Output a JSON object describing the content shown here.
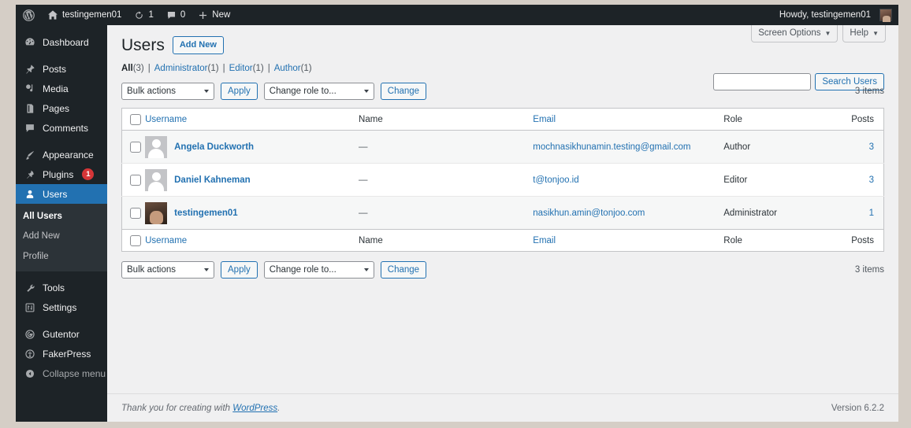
{
  "adminbar": {
    "logo_icon": "wordpress-logo-icon",
    "site_name": "testingemen01",
    "home_icon": "home-icon",
    "updates_icon": "updates-icon",
    "updates_count": "1",
    "comments_icon": "comment-bubble-icon",
    "comments_count": "0",
    "new_icon": "plus-icon",
    "new_label": "New",
    "howdy": "Howdy, testingemen01",
    "avatar_icon": "user-avatar"
  },
  "sidebar": {
    "items": [
      {
        "label": "Dashboard",
        "icon": "dashboard-icon",
        "badge": null,
        "current": false
      },
      {
        "label": "Posts",
        "icon": "pin-icon",
        "badge": null,
        "current": false
      },
      {
        "label": "Media",
        "icon": "media-icon",
        "badge": null,
        "current": false
      },
      {
        "label": "Pages",
        "icon": "pages-icon",
        "badge": null,
        "current": false
      },
      {
        "label": "Comments",
        "icon": "comment-bubble-icon",
        "badge": null,
        "current": false
      },
      {
        "label": "Appearance",
        "icon": "appearance-brush-icon",
        "badge": null,
        "current": false
      },
      {
        "label": "Plugins",
        "icon": "plugins-plug-icon",
        "badge": "1",
        "current": false
      },
      {
        "label": "Users",
        "icon": "users-icon",
        "badge": null,
        "current": true
      },
      {
        "label": "Tools",
        "icon": "tools-wrench-icon",
        "badge": null,
        "current": false
      },
      {
        "label": "Settings",
        "icon": "settings-sliders-icon",
        "badge": null,
        "current": false
      },
      {
        "label": "Gutentor",
        "icon": "gutentor-icon",
        "badge": null,
        "current": false
      },
      {
        "label": "FakerPress",
        "icon": "fakerpress-icon",
        "badge": null,
        "current": false
      },
      {
        "label": "Collapse menu",
        "icon": "collapse-arrow-icon",
        "badge": null,
        "current": false
      }
    ],
    "submenu": [
      {
        "label": "All Users",
        "current": true
      },
      {
        "label": "Add New",
        "current": false
      },
      {
        "label": "Profile",
        "current": false
      }
    ]
  },
  "screen_meta": {
    "screen_options": "Screen Options",
    "help": "Help",
    "caret_icon": "chevron-down-icon"
  },
  "page": {
    "title": "Users",
    "add_new": "Add New"
  },
  "filters": {
    "all_label": "All",
    "all_count": "(3)",
    "links": [
      {
        "label": "Administrator",
        "count": "(1)"
      },
      {
        "label": "Editor",
        "count": "(1)"
      },
      {
        "label": "Author",
        "count": "(1)"
      }
    ],
    "separator": "|"
  },
  "search": {
    "value": "",
    "placeholder": "",
    "button": "Search Users"
  },
  "tablenav_top": {
    "bulk_actions": "Bulk actions",
    "apply": "Apply",
    "change_role": "Change role to...",
    "change": "Change",
    "items": "3 items"
  },
  "tablenav_bottom": {
    "bulk_actions": "Bulk actions",
    "apply": "Apply",
    "change_role": "Change role to...",
    "change": "Change",
    "items": "3 items"
  },
  "table": {
    "columns": {
      "username": "Username",
      "name": "Name",
      "email": "Email",
      "role": "Role",
      "posts": "Posts"
    },
    "rows": [
      {
        "username": "Angela Duckworth",
        "name": "—",
        "email": "mochnasikhunamin.testing@gmail.com",
        "role": "Author",
        "posts": "3",
        "avatar": "placeholder"
      },
      {
        "username": "Daniel Kahneman",
        "name": "—",
        "email": "t@tonjoo.id",
        "role": "Editor",
        "posts": "3",
        "avatar": "placeholder"
      },
      {
        "username": "testingemen01",
        "name": "—",
        "email": "nasikhun.amin@tonjoo.com",
        "role": "Administrator",
        "posts": "1",
        "avatar": "photo"
      }
    ]
  },
  "footer": {
    "thanks_prefix": "Thank you for creating with ",
    "wordpress_link": "WordPress",
    "thanks_suffix": ".",
    "version": "Version 6.2.2"
  },
  "colors": {
    "admin_dark": "#1d2327",
    "submenu_dark": "#2c3338",
    "accent_blue": "#2271b1",
    "badge_red": "#d63638",
    "content_bg": "#f0f0f1",
    "page_surround": "#d5cec6"
  }
}
